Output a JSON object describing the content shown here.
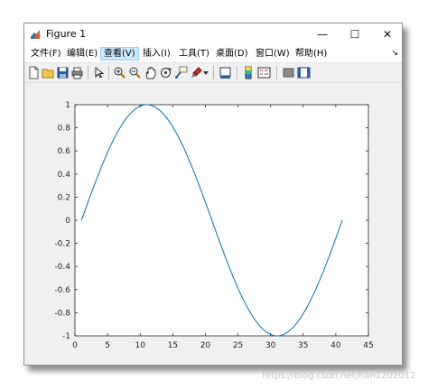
{
  "window": {
    "title": "Figure 1",
    "controls": {
      "minimize": "—",
      "maximize": "☐",
      "close": "✕"
    }
  },
  "menubar": {
    "items": [
      {
        "label": "文件(F)"
      },
      {
        "label": "编辑(E)"
      },
      {
        "label": "查看(V)",
        "active": true
      },
      {
        "label": "插入(I)"
      },
      {
        "label": "工具(T)"
      },
      {
        "label": "桌面(D)"
      },
      {
        "label": "窗口(W)"
      },
      {
        "label": "帮助(H)"
      }
    ],
    "overflow_arrow": "↘"
  },
  "toolbar": {
    "icons": [
      "new-figure-icon",
      "open-file-icon",
      "save-icon",
      "print-icon",
      "select-arrow-icon",
      "zoom-in-icon",
      "zoom-out-icon",
      "pan-hand-icon",
      "rotate-3d-icon",
      "data-cursor-icon",
      "brush-icon",
      "link-plot-icon",
      "insert-colorbar-icon",
      "insert-legend-icon",
      "hide-plot-tools-icon",
      "show-plot-tools-icon"
    ]
  },
  "chart_data": {
    "type": "line",
    "series": [
      {
        "color": "#0072bd",
        "function": "sin(2*pi*(x-1)/40)",
        "x": [
          1,
          2,
          3,
          4,
          5,
          6,
          7,
          8,
          9,
          10,
          11,
          12,
          13,
          14,
          15,
          16,
          17,
          18,
          19,
          20,
          21,
          22,
          23,
          24,
          25,
          26,
          27,
          28,
          29,
          30,
          31,
          32,
          33,
          34,
          35,
          36,
          37,
          38,
          39,
          40,
          41
        ],
        "y": [
          0,
          0.156,
          0.309,
          0.454,
          0.588,
          0.707,
          0.809,
          0.891,
          0.951,
          0.988,
          1,
          0.988,
          0.951,
          0.891,
          0.809,
          0.707,
          0.588,
          0.454,
          0.309,
          0.156,
          0,
          -0.156,
          -0.309,
          -0.454,
          -0.588,
          -0.707,
          -0.809,
          -0.891,
          -0.951,
          -0.988,
          -1,
          -0.988,
          -0.951,
          -0.891,
          -0.809,
          -0.707,
          -0.588,
          -0.454,
          -0.309,
          -0.156,
          0
        ]
      }
    ],
    "xlim": [
      0,
      45
    ],
    "ylim": [
      -1,
      1
    ],
    "xticks": [
      0,
      5,
      10,
      15,
      20,
      25,
      30,
      35,
      40,
      45
    ],
    "yticks": [
      -1,
      -0.8,
      -0.6,
      -0.4,
      -0.2,
      0,
      0.2,
      0.4,
      0.6,
      0.8,
      1
    ],
    "xtick_labels": [
      "0",
      "5",
      "10",
      "15",
      "20",
      "25",
      "30",
      "35",
      "40",
      "45"
    ],
    "ytick_labels": [
      "-1",
      "-0.8",
      "-0.6",
      "-0.4",
      "-0.2",
      "0",
      "0.2",
      "0.4",
      "0.6",
      "0.8",
      "1"
    ],
    "grid": false,
    "title": "",
    "xlabel": "",
    "ylabel": ""
  },
  "watermark": "https://blog.csdn.net/han1202012"
}
